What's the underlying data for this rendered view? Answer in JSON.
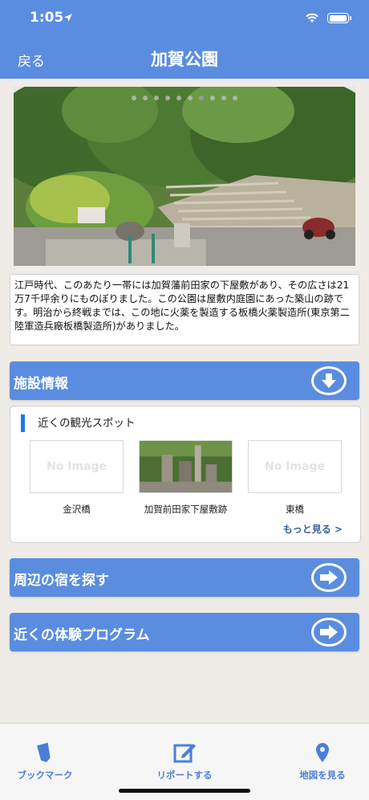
{
  "status": {
    "time": "1:05"
  },
  "nav": {
    "back": "戻る",
    "title": "加賀公園"
  },
  "carousel": {
    "page_count": 10,
    "active_index": 6
  },
  "description": "江戸時代、このあたり一帯には加賀藩前田家の下屋敷があり、その広さは21万7千坪余りにものぼりました。この公園は屋敷内庭園にあった築山の跡です。明治から終戦までは、この地に火薬を製造する板橋火薬製造所(東京第二陸軍造兵廠板橋製造所)がありました。",
  "facility": {
    "label": "施設情報"
  },
  "nearby": {
    "header": "近くの観光スポット",
    "items": [
      {
        "name": "金沢橋",
        "image": "No Image"
      },
      {
        "name": "加賀前田家下屋敷跡",
        "image": ""
      },
      {
        "name": "東橋",
        "image": "No Image"
      }
    ],
    "more": "もっと見る >"
  },
  "lodging": {
    "label": "周辺の宿を探す"
  },
  "experience": {
    "label": "近くの体験プログラム"
  },
  "tabs": [
    {
      "label": "ブックマーク",
      "icon": "bookmark-icon"
    },
    {
      "label": "リポートする",
      "icon": "report-edit-icon"
    },
    {
      "label": "地図を見る",
      "icon": "map-pin-icon"
    }
  ],
  "colors": {
    "header": "#5a8de0",
    "accent": "#1f7ae6",
    "tab": "#4a7fd8",
    "background": "#efebe6"
  }
}
